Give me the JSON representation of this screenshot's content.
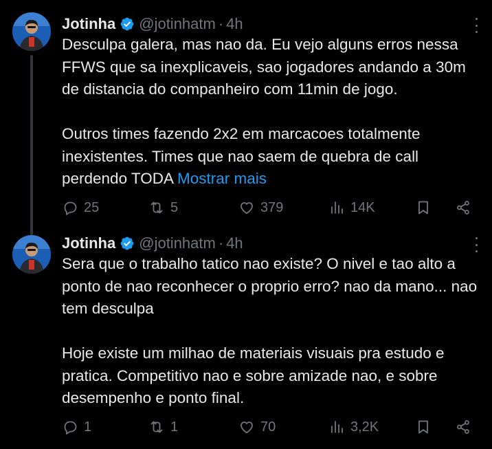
{
  "tweets": [
    {
      "name": "Jotinha",
      "handle": "@jotinhatm",
      "dot": "·",
      "time": "4h",
      "text": "Desculpa galera, mas nao da. Eu vejo alguns erros nessa FFWS que sa inexplicaveis, sao jogadores andando a 30m de distancia do companheiro com 11min de jogo.\n\nOutros times fazendo 2x2 em marcacoes totalmente inexistentes. Times que nao saem de quebra de call perdendo TODA ",
      "show_more": "Mostrar mais",
      "replies": "25",
      "retweets": "5",
      "likes": "379",
      "views": "14K"
    },
    {
      "name": "Jotinha",
      "handle": "@jotinhatm",
      "dot": "·",
      "time": "4h",
      "text": "Sera que o trabalho tatico nao existe? O nivel e tao alto a ponto de nao reconhecer o proprio erro? nao da mano... nao tem desculpa\n\nHoje existe um milhao de materiais visuais pra estudo e pratica. Competitivo nao e sobre amizade nao, e sobre desempenho e ponto final.",
      "replies": "1",
      "retweets": "1",
      "likes": "70",
      "views": "3,2K"
    }
  ],
  "icons": {
    "verified": "verified-badge-icon",
    "reply": "reply-icon",
    "retweet": "retweet-icon",
    "like": "heart-icon",
    "views": "views-icon",
    "bookmark": "bookmark-icon",
    "share": "share-icon",
    "more": "more-icon"
  },
  "colors": {
    "background": "#000000",
    "text": "#e7e9ea",
    "muted": "#71767b",
    "link": "#1d9bf0",
    "verified": "#1d9bf0",
    "thread_line": "#333639"
  }
}
